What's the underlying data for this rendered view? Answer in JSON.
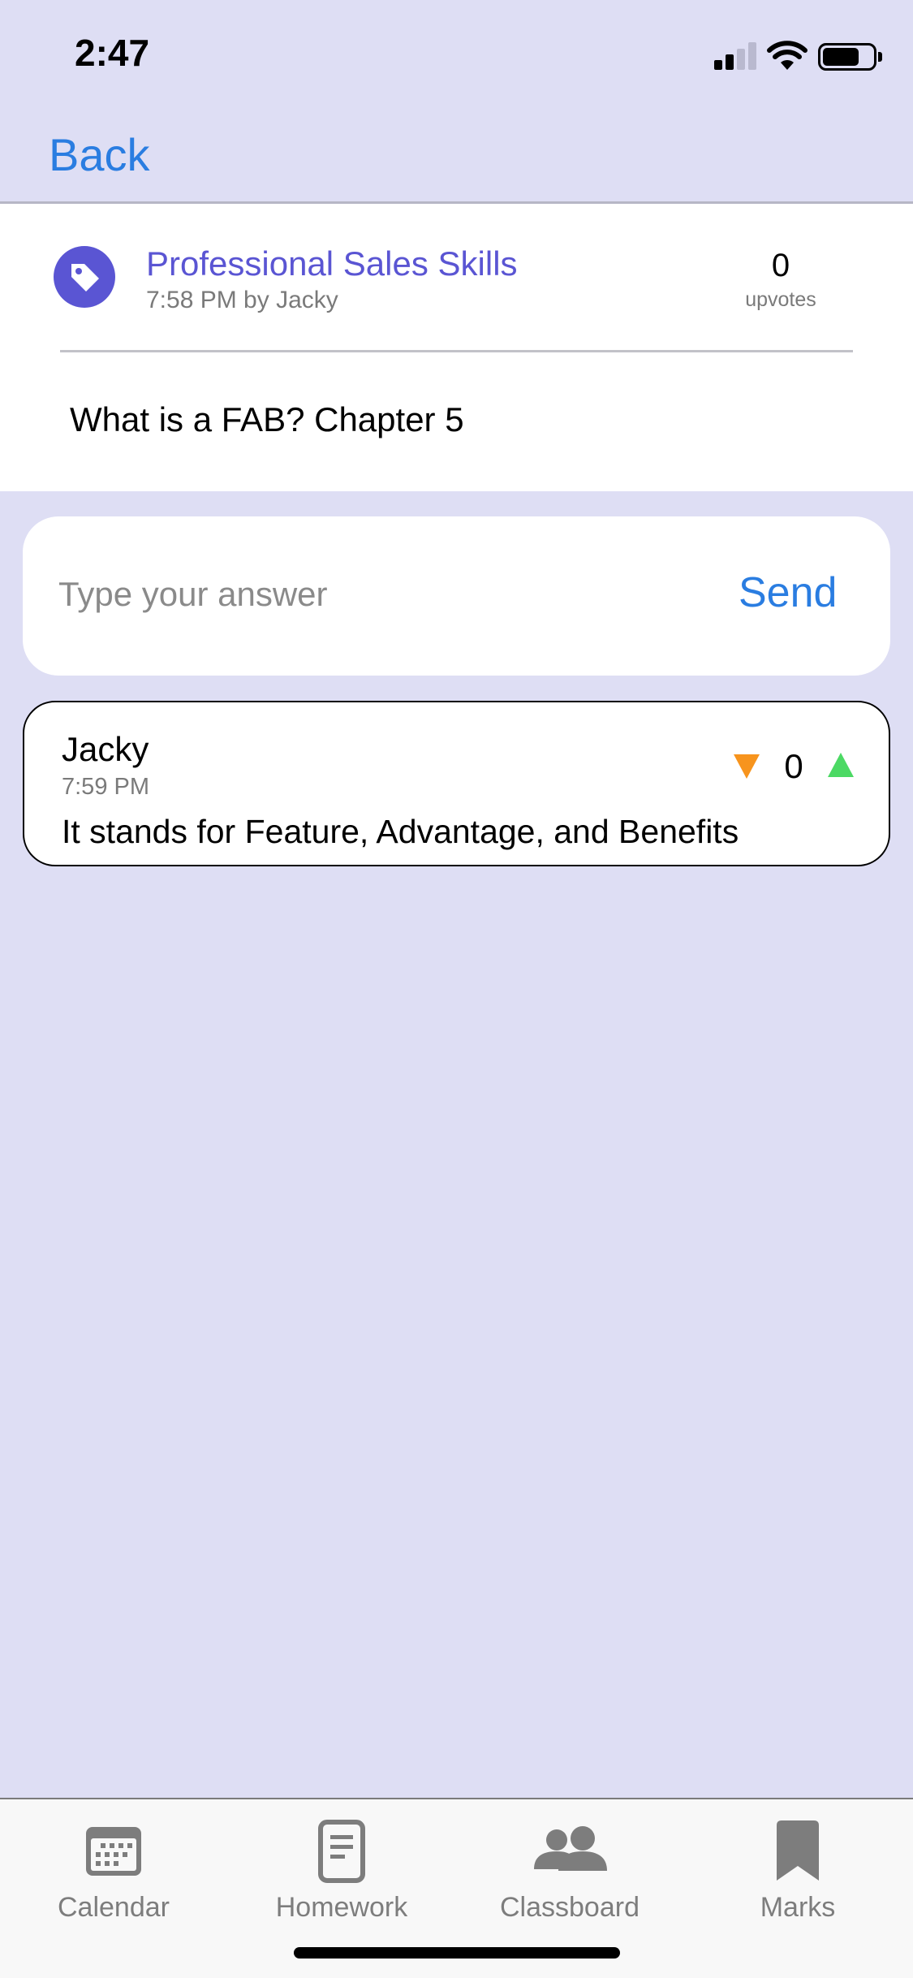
{
  "status_bar": {
    "time": "2:47"
  },
  "nav": {
    "back_label": "Back"
  },
  "post": {
    "title": "Professional Sales Skills",
    "meta": "7:58 PM by Jacky",
    "upvotes": "0",
    "upvotes_label": "upvotes",
    "question": "What is a FAB? Chapter 5"
  },
  "answer_input": {
    "placeholder": "Type your answer",
    "send_label": "Send"
  },
  "answers": [
    {
      "author": "Jacky",
      "time": "7:59 PM",
      "text": "It stands for Feature, Advantage, and Benefits",
      "votes": "0"
    }
  ],
  "tabs": [
    {
      "label": "Calendar",
      "icon": "calendar-icon"
    },
    {
      "label": "Homework",
      "icon": "document-icon"
    },
    {
      "label": "Classboard",
      "icon": "people-icon"
    },
    {
      "label": "Marks",
      "icon": "bookmark-icon"
    }
  ],
  "colors": {
    "background": "#dedef4",
    "accent_blue": "#2a7de1",
    "accent_purple": "#5a55d3",
    "downvote": "#f7941d",
    "upvote": "#4cd964",
    "tab_gray": "#7d7d7d"
  }
}
